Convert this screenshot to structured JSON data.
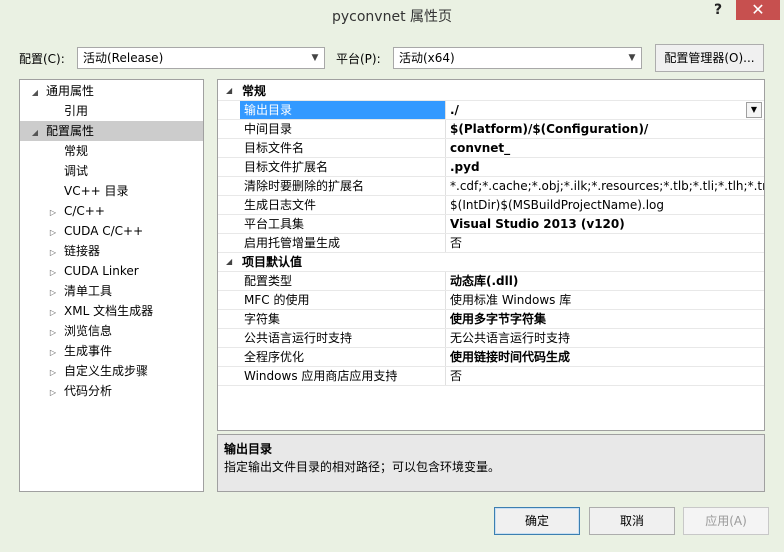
{
  "window": {
    "title": "pyconvnet 属性页",
    "help": "?",
    "close": "✕"
  },
  "config": {
    "label": "配置(C):",
    "value": "活动(Release)"
  },
  "platform": {
    "label": "平台(P):",
    "value": "活动(x64)"
  },
  "config_manager": "配置管理器(O)...",
  "tree": [
    {
      "label": "通用属性",
      "toggle": "◢"
    },
    {
      "label": "引用",
      "toggle": ""
    },
    {
      "label": "配置属性",
      "toggle": "◢"
    },
    {
      "label": "常规",
      "toggle": ""
    },
    {
      "label": "调试",
      "toggle": ""
    },
    {
      "label": "VC++ 目录",
      "toggle": ""
    },
    {
      "label": "C/C++",
      "toggle": "▷"
    },
    {
      "label": "CUDA C/C++",
      "toggle": "▷"
    },
    {
      "label": "链接器",
      "toggle": "▷"
    },
    {
      "label": "CUDA Linker",
      "toggle": "▷"
    },
    {
      "label": "清单工具",
      "toggle": "▷"
    },
    {
      "label": "XML 文档生成器",
      "toggle": "▷"
    },
    {
      "label": "浏览信息",
      "toggle": "▷"
    },
    {
      "label": "生成事件",
      "toggle": "▷"
    },
    {
      "label": "自定义生成步骤",
      "toggle": "▷"
    },
    {
      "label": "代码分析",
      "toggle": "▷"
    }
  ],
  "grid": {
    "cat1": "常规",
    "cat2": "项目默认值",
    "toggle": "◢",
    "rows1": [
      {
        "name": "输出目录",
        "value": "./"
      },
      {
        "name": "中间目录",
        "value": "$(Platform)/$(Configuration)/"
      },
      {
        "name": "目标文件名",
        "value": "convnet_"
      },
      {
        "name": "目标文件扩展名",
        "value": ".pyd"
      },
      {
        "name": "清除时要删除的扩展名",
        "value": "*.cdf;*.cache;*.obj;*.ilk;*.resources;*.tlb;*.tli;*.tlh;*.tmp;*.r"
      },
      {
        "name": "生成日志文件",
        "value": "$(IntDir)$(MSBuildProjectName).log"
      },
      {
        "name": "平台工具集",
        "value": "Visual Studio 2013 (v120)"
      },
      {
        "name": "启用托管增量生成",
        "value": "否"
      }
    ],
    "rows2": [
      {
        "name": "配置类型",
        "value": "动态库(.dll)"
      },
      {
        "name": "MFC 的使用",
        "value": "使用标准 Windows 库"
      },
      {
        "name": "字符集",
        "value": "使用多字节字符集"
      },
      {
        "name": "公共语言运行时支持",
        "value": "无公共语言运行时支持"
      },
      {
        "name": "全程序优化",
        "value": "使用链接时间代码生成"
      },
      {
        "name": "Windows 应用商店应用支持",
        "value": "否"
      }
    ],
    "dropdown": "▼"
  },
  "description": {
    "title": "输出目录",
    "text": "指定输出文件目录的相对路径；可以包含环境变量。"
  },
  "buttons": {
    "ok": "确定",
    "cancel": "取消",
    "apply": "应用(A)"
  }
}
